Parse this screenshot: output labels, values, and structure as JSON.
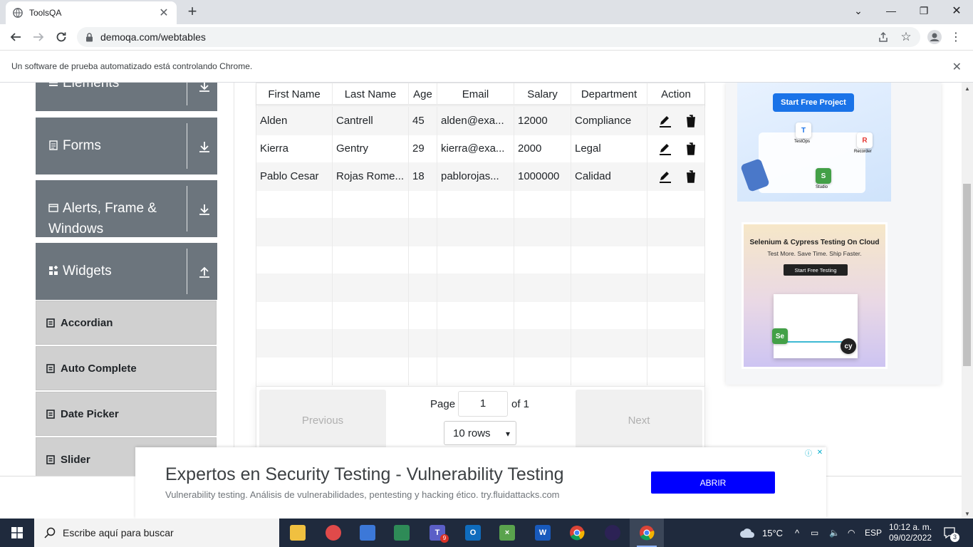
{
  "browser": {
    "tab_title": "ToolsQA",
    "url": "demoqa.com/webtables",
    "infobar_text": "Un software de prueba automatizado está controlando Chrome."
  },
  "sidebar": {
    "groups": [
      {
        "label": "Elements"
      },
      {
        "label": "Forms"
      },
      {
        "label": "Alerts, Frame &",
        "label2": "Windows"
      },
      {
        "label": "Widgets"
      }
    ],
    "items": [
      {
        "label": "Accordian"
      },
      {
        "label": "Auto Complete"
      },
      {
        "label": "Date Picker"
      },
      {
        "label": "Slider"
      }
    ]
  },
  "table": {
    "headers": [
      "First Name",
      "Last Name",
      "Age",
      "Email",
      "Salary",
      "Department",
      "Action"
    ],
    "rows": [
      [
        "Alden",
        "Cantrell",
        "45",
        "alden@exa...",
        "12000",
        "Compliance"
      ],
      [
        "Kierra",
        "Gentry",
        "29",
        "kierra@exa...",
        "2000",
        "Legal"
      ],
      [
        "Pablo Cesar",
        "Rojas Rome...",
        "18",
        "pablorojas...",
        "1000000",
        "Calidad"
      ]
    ]
  },
  "pagination": {
    "previous": "Previous",
    "next": "Next",
    "page_label": "Page",
    "page_value": "1",
    "of_label": "of 1",
    "rows_selected": "10 rows"
  },
  "ads": {
    "ad1_button": "Start Free Project",
    "ad1_chips": [
      "TestOps",
      "Recorder",
      "Studio"
    ],
    "ad2_title": "Selenium & Cypress Testing On Cloud",
    "ad2_subtitle": "Test More. Save Time. Ship Faster.",
    "ad2_button": "Start Free Testing"
  },
  "banner": {
    "title": "Expertos en Security Testing - Vulnerability Testing",
    "subtitle": "Vulnerability testing. Análisis de vulnerabilidades, pentesting y hacking ético. try.fluidattacks.com",
    "button": "ABRIR"
  },
  "taskbar": {
    "search_placeholder": "Escribe aquí para buscar",
    "weather": "15°C",
    "language": "ESP",
    "time": "10:12 a. m.",
    "date": "09/02/2022",
    "notifications": "3",
    "teams_badge": "9"
  },
  "colors": {
    "sidebar_group": "#6c757d",
    "sidebar_item": "#d0d0d0",
    "banner_button": "#0000ff",
    "taskbar": "#1f2a3d"
  }
}
